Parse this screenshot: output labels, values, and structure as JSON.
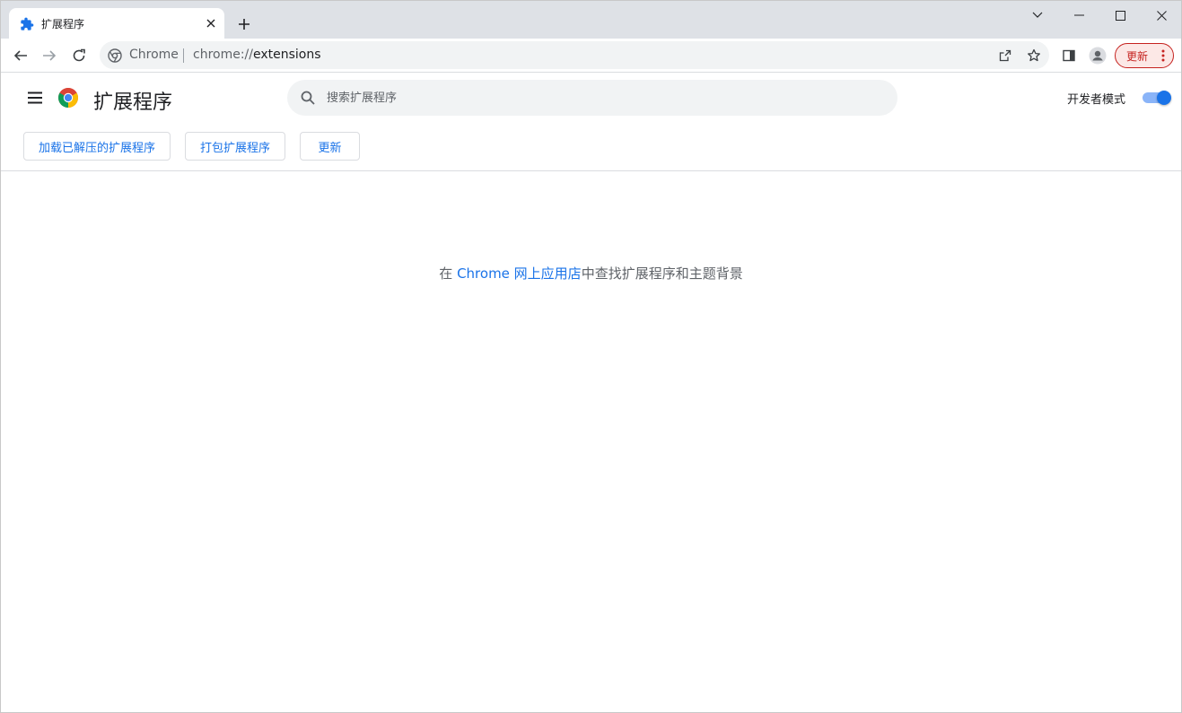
{
  "tab": {
    "title": "扩展程序",
    "icon": "puzzle-icon"
  },
  "window_controls": {
    "dropdown": "chevron-down-icon",
    "minimize": "minimize-icon",
    "maximize": "maximize-icon",
    "close": "close-icon"
  },
  "omnibox": {
    "chip": "Chrome",
    "url_scheme": "chrome://",
    "url_path": "extensions"
  },
  "toolbar": {
    "update_label": "更新"
  },
  "header": {
    "title": "扩展程序",
    "search_placeholder": "搜索扩展程序",
    "dev_mode_label": "开发者模式",
    "dev_mode_on": true
  },
  "actions": {
    "load_unpacked": "加载已解压的扩展程序",
    "pack": "打包扩展程序",
    "update": "更新"
  },
  "empty_state": {
    "prefix": "在 ",
    "link": "Chrome 网上应用店",
    "suffix": "中查找扩展程序和主题背景"
  },
  "colors": {
    "accent": "#1a73e8",
    "update_red": "#c5221f",
    "tabstrip": "#dee1e6"
  }
}
